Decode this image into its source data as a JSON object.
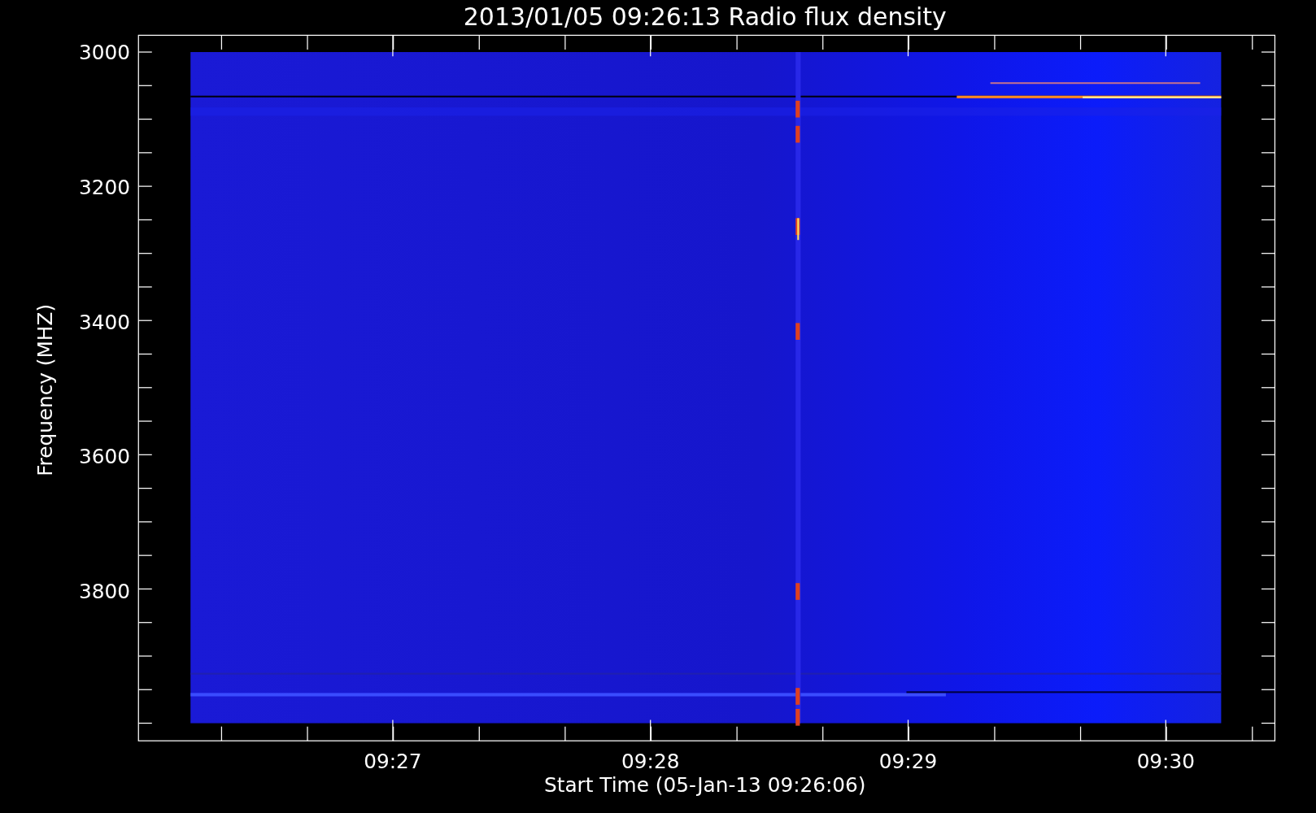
{
  "title": "2013/01/05 09:26:13 Radio flux density",
  "y_axis": {
    "label": "Frequency (MHZ)",
    "ticks": [
      "3000",
      "3200",
      "3400",
      "3600",
      "3800"
    ]
  },
  "x_axis": {
    "label": "Start Time (05-Jan-13 09:26:06)",
    "ticks": [
      "09:27",
      "09:28",
      "09:29",
      "09:30"
    ]
  }
}
